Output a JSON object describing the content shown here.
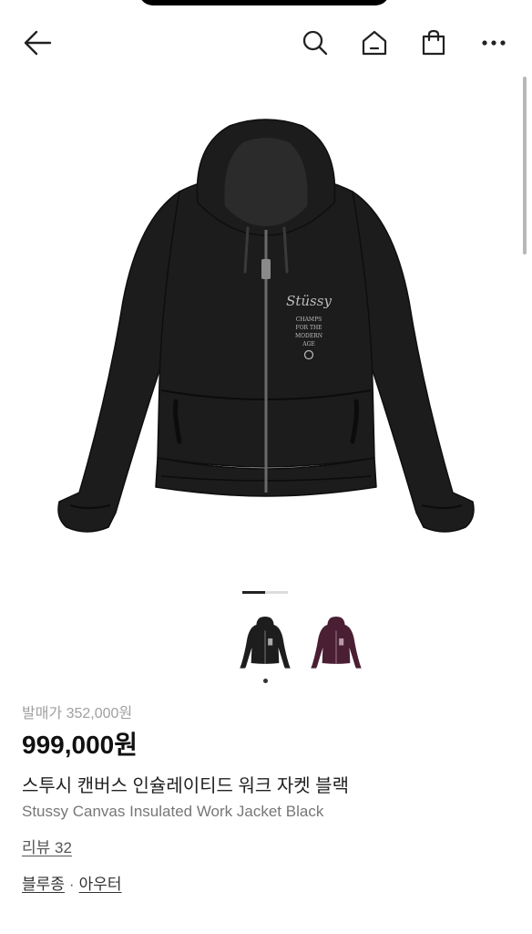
{
  "icons": {
    "back": "arrow-left-icon",
    "search": "search-icon",
    "home": "home-icon",
    "cart": "shopping-bag-icon",
    "more": "more-horizontal-icon"
  },
  "product": {
    "original_price": "발매가 352,000원",
    "price": "999,000원",
    "name_ko": "스투시 캔버스 인슐레이티드 워크 자켓 블랙",
    "name_en": "Stussy Canvas Insulated Work Jacket Black",
    "review_label": "리뷰 32",
    "categories": [
      "블루종",
      "아우터"
    ],
    "category_separator": "·",
    "graphic_text": [
      "Stüssy",
      "CHAMPS",
      "FOR THE",
      "MODERN",
      "AGE"
    ],
    "thumbnails": [
      {
        "color": "#1d1d1d",
        "selected": true
      },
      {
        "color": "#4a1f33",
        "selected": false
      }
    ]
  },
  "gallery": {
    "current_index": 1,
    "total": 2
  },
  "colors": {
    "jacket": "#1c1c1c",
    "price": "#111111",
    "muted": "#a0a0a0"
  }
}
